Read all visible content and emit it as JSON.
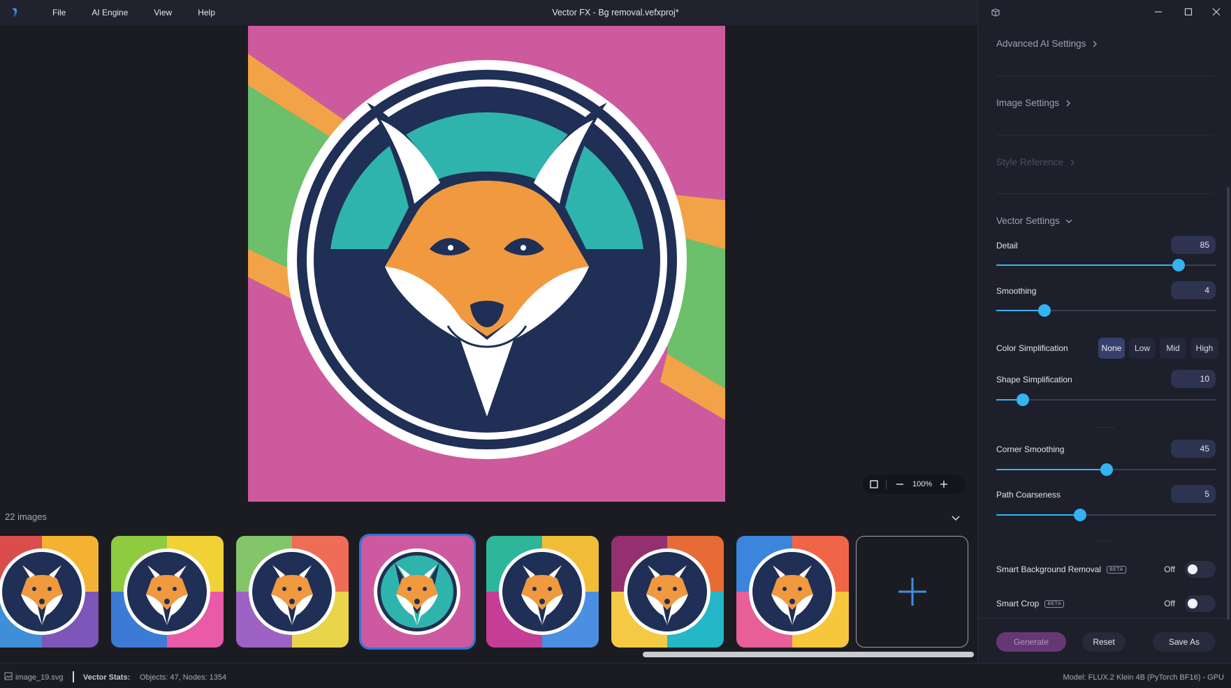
{
  "window": {
    "title": "Vector FX - Bg removal.vefxproj*"
  },
  "menu": {
    "items": [
      "File",
      "AI Engine",
      "View",
      "Help"
    ]
  },
  "panel": {
    "sections": {
      "advanced": "Advanced AI Settings",
      "image": "Image Settings",
      "style": "Style Reference",
      "vector": "Vector Settings"
    },
    "sliders": {
      "detail": {
        "label": "Detail",
        "value": "85",
        "fraction": 0.83
      },
      "smoothing": {
        "label": "Smoothing",
        "value": "4",
        "fraction": 0.22
      },
      "shape": {
        "label": "Shape Simplification",
        "value": "10",
        "fraction": 0.12
      },
      "corner": {
        "label": "Corner Smoothing",
        "value": "45",
        "fraction": 0.5
      },
      "path": {
        "label": "Path Coarseness",
        "value": "5",
        "fraction": 0.38
      }
    },
    "color_simplification": {
      "label": "Color Simplification",
      "options": [
        "None",
        "Low",
        "Mid",
        "High"
      ],
      "selected": "None"
    },
    "toggles": {
      "bg_removal": {
        "label": "Smart Background Removal",
        "badge": "BETA",
        "state": "Off"
      },
      "smart_crop": {
        "label": "Smart Crop",
        "badge": "BETA",
        "state": "Off"
      }
    },
    "buttons": {
      "generate": "Generate",
      "reset": "Reset",
      "save_as": "Save As"
    }
  },
  "canvas": {
    "zoom": "100%"
  },
  "gallery": {
    "count": "22 images",
    "selected_index": 3,
    "thumbnail_backgrounds": [
      [
        "#d94d4d",
        "#f4b233",
        "#3f8fd8",
        "#7c56b8"
      ],
      [
        "#8ecb3f",
        "#f0d236",
        "#3b7bd6",
        "#e95aa7"
      ],
      [
        "#84c56a",
        "#ef6c57",
        "#9c62c4",
        "#e8d54a"
      ],
      [
        "#cd5aa1",
        "#cd5aa1",
        "#cd5aa1",
        "#cd5aa1"
      ],
      [
        "#2eb69b",
        "#f2bd36",
        "#c53d94",
        "#4a8fe1"
      ],
      [
        "#94306f",
        "#e76b35",
        "#f4c944",
        "#23b7c8"
      ],
      [
        "#3c85dc",
        "#f06547",
        "#e95f99",
        "#f6c63c"
      ]
    ],
    "colors": {
      "accent": "#2c78d6",
      "slider": "#33b3f2",
      "generate": "#653873"
    }
  },
  "status": {
    "file": "image_19.svg",
    "stats_label": "Vector Stats:",
    "stats": "Objects: 47, Nodes: 1354",
    "model": "Model: FLUX.2 Klein 4B (PyTorch BF16) - GPU"
  }
}
